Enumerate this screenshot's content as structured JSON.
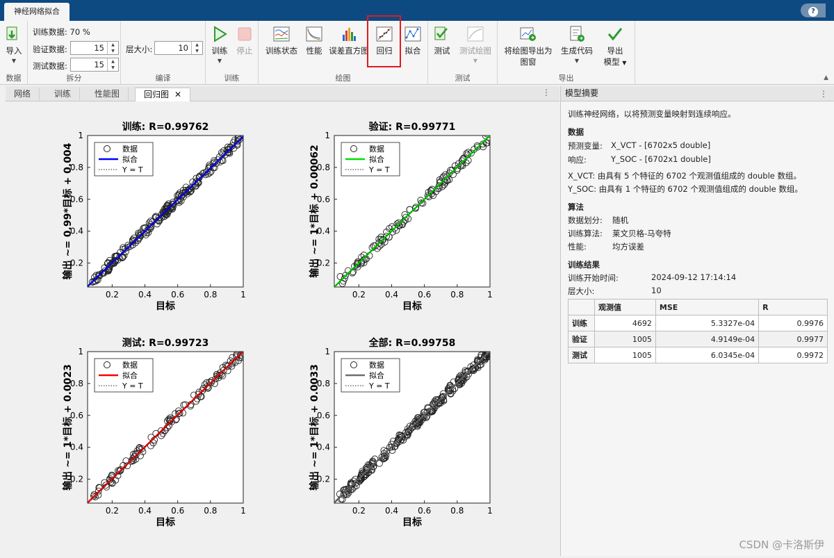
{
  "app": {
    "tab_title": "神经网络拟合",
    "help": "?"
  },
  "ribbon": {
    "groups": [
      "数据",
      "拆分",
      "编译",
      "训练",
      "绘图",
      "测试",
      "导出"
    ],
    "import_label": "导入",
    "split": {
      "train_text": "训练数据: 70 %",
      "val_label": "验证数据:",
      "val_value": "15",
      "test_label": "测试数据:",
      "test_value": "15"
    },
    "compile": {
      "layer_label": "层大小:",
      "layer_value": "10"
    },
    "train": {
      "train_label": "训练",
      "stop_label": "停止"
    },
    "plots": {
      "train_state": "训练状态",
      "perf": "性能",
      "hist": "误差直方图",
      "reg": "回归",
      "fit": "拟合"
    },
    "test": {
      "test_label": "测试",
      "test_plot": "测试绘图"
    },
    "export": {
      "export_plot": "将绘图导出为",
      "export_plot2": "图窗",
      "gen_code": "生成代码",
      "export_model": "导出",
      "export_model2": "模型"
    }
  },
  "doc_tabs": [
    "网络",
    "训练",
    "性能图",
    "回归图"
  ],
  "colors": {
    "train": "#0000ff",
    "val": "#00e000",
    "test": "#ff0000",
    "all": "#6e6e6e",
    "highlight": "#e0191f"
  },
  "plots": [
    {
      "title": "训练: R=0.99762",
      "ylabel": "输出 ~= 0.99*目标 + 0.004",
      "xlabel": "目标",
      "fit_label": "拟合",
      "data_label": "数据",
      "yt_label": "Y = T"
    },
    {
      "title": "验证: R=0.99771",
      "ylabel": "输出 ~= 1*目标 + 0.00062",
      "xlabel": "目标",
      "fit_label": "拟合",
      "data_label": "数据",
      "yt_label": "Y = T"
    },
    {
      "title": "测试: R=0.99723",
      "ylabel": "输出 ~= 1*目标 + 0.0023",
      "xlabel": "目标",
      "fit_label": "拟合",
      "data_label": "数据",
      "yt_label": "Y = T"
    },
    {
      "title": "全部: R=0.99758",
      "ylabel": "输出 ~= 1*目标 + 0.0033",
      "xlabel": "目标",
      "fit_label": "拟合",
      "data_label": "数据",
      "yt_label": "Y = T"
    }
  ],
  "chart_data": [
    {
      "type": "scatter",
      "title": "训练: R=0.99762",
      "xlabel": "目标",
      "ylabel": "输出 ~= 0.99*目标 + 0.004",
      "xlim": [
        0.05,
        1
      ],
      "ylim": [
        0.05,
        1
      ],
      "xticks": [
        "0.2",
        "0.4",
        "0.6",
        "0.8",
        "1"
      ],
      "yticks": [
        "0.2",
        "0.4",
        "0.6",
        "0.8",
        "1"
      ],
      "fit": {
        "slope": 0.99,
        "intercept": 0.004
      },
      "R": 0.99762,
      "legend": [
        "数据",
        "拟合",
        "Y = T"
      ],
      "legend_position": "top-left"
    },
    {
      "type": "scatter",
      "title": "验证: R=0.99771",
      "xlabel": "目标",
      "ylabel": "输出 ~= 1*目标 + 0.00062",
      "xlim": [
        0.05,
        1
      ],
      "ylim": [
        0.05,
        1
      ],
      "xticks": [
        "0.2",
        "0.4",
        "0.6",
        "0.8",
        "1"
      ],
      "yticks": [
        "0.2",
        "0.4",
        "0.6",
        "0.8",
        "1"
      ],
      "fit": {
        "slope": 1,
        "intercept": 0.00062
      },
      "R": 0.99771,
      "legend": [
        "数据",
        "拟合",
        "Y = T"
      ],
      "legend_position": "top-left"
    },
    {
      "type": "scatter",
      "title": "测试: R=0.99723",
      "xlabel": "目标",
      "ylabel": "输出 ~= 1*目标 + 0.0023",
      "xlim": [
        0.05,
        1
      ],
      "ylim": [
        0.05,
        1
      ],
      "xticks": [
        "0.2",
        "0.4",
        "0.6",
        "0.8",
        "1"
      ],
      "yticks": [
        "0.2",
        "0.4",
        "0.6",
        "0.8",
        "1"
      ],
      "fit": {
        "slope": 1,
        "intercept": 0.0023
      },
      "R": 0.99723,
      "legend": [
        "数据",
        "拟合",
        "Y = T"
      ],
      "legend_position": "top-left"
    },
    {
      "type": "scatter",
      "title": "全部: R=0.99758",
      "xlabel": "目标",
      "ylabel": "输出 ~= 1*目标 + 0.0033",
      "xlim": [
        0.05,
        1
      ],
      "ylim": [
        0.05,
        1
      ],
      "xticks": [
        "0.2",
        "0.4",
        "0.6",
        "0.8",
        "1"
      ],
      "yticks": [
        "0.2",
        "0.4",
        "0.6",
        "0.8",
        "1"
      ],
      "fit": {
        "slope": 1,
        "intercept": 0.0033
      },
      "R": 0.99758,
      "legend": [
        "数据",
        "拟合",
        "Y = T"
      ],
      "legend_position": "top-left"
    }
  ],
  "summary": {
    "title": "模型摘要",
    "intro": "训练神经网络，以将预测变量映射到连续响应。",
    "data_h": "数据",
    "pred_label": "预测变量:",
    "pred_value": "X_VCT - [6702x5 double]",
    "resp_label": "响应:",
    "resp_value": "Y_SOC - [6702x1 double]",
    "xdesc": "X_VCT: 由具有 5 个特征的 6702 个观测值组成的 double 数组。",
    "ydesc": "Y_SOC: 由具有 1 个特征的 6702 个观测值组成的 double 数组。",
    "algo_h": "算法",
    "split_label": "数据划分:",
    "split_value": "随机",
    "algo_label": "训练算法:",
    "algo_value": "莱文贝格-马夸特",
    "perf_label": "性能:",
    "perf_value": "均方误差",
    "res_h": "训练结果",
    "start_label": "训练开始时间:",
    "start_value": "2024-09-12 17:14:14",
    "layer_label": "层大小:",
    "layer_value": "10",
    "table": {
      "headers": [
        "观测值",
        "MSE",
        "R"
      ],
      "rows": [
        [
          "训练",
          "4692",
          "5.3327e-04",
          "0.9976"
        ],
        [
          "验证",
          "1005",
          "4.9149e-04",
          "0.9977"
        ],
        [
          "测试",
          "1005",
          "6.0345e-04",
          "0.9972"
        ]
      ]
    }
  },
  "watermark": "CSDN @卡洛斯伊"
}
